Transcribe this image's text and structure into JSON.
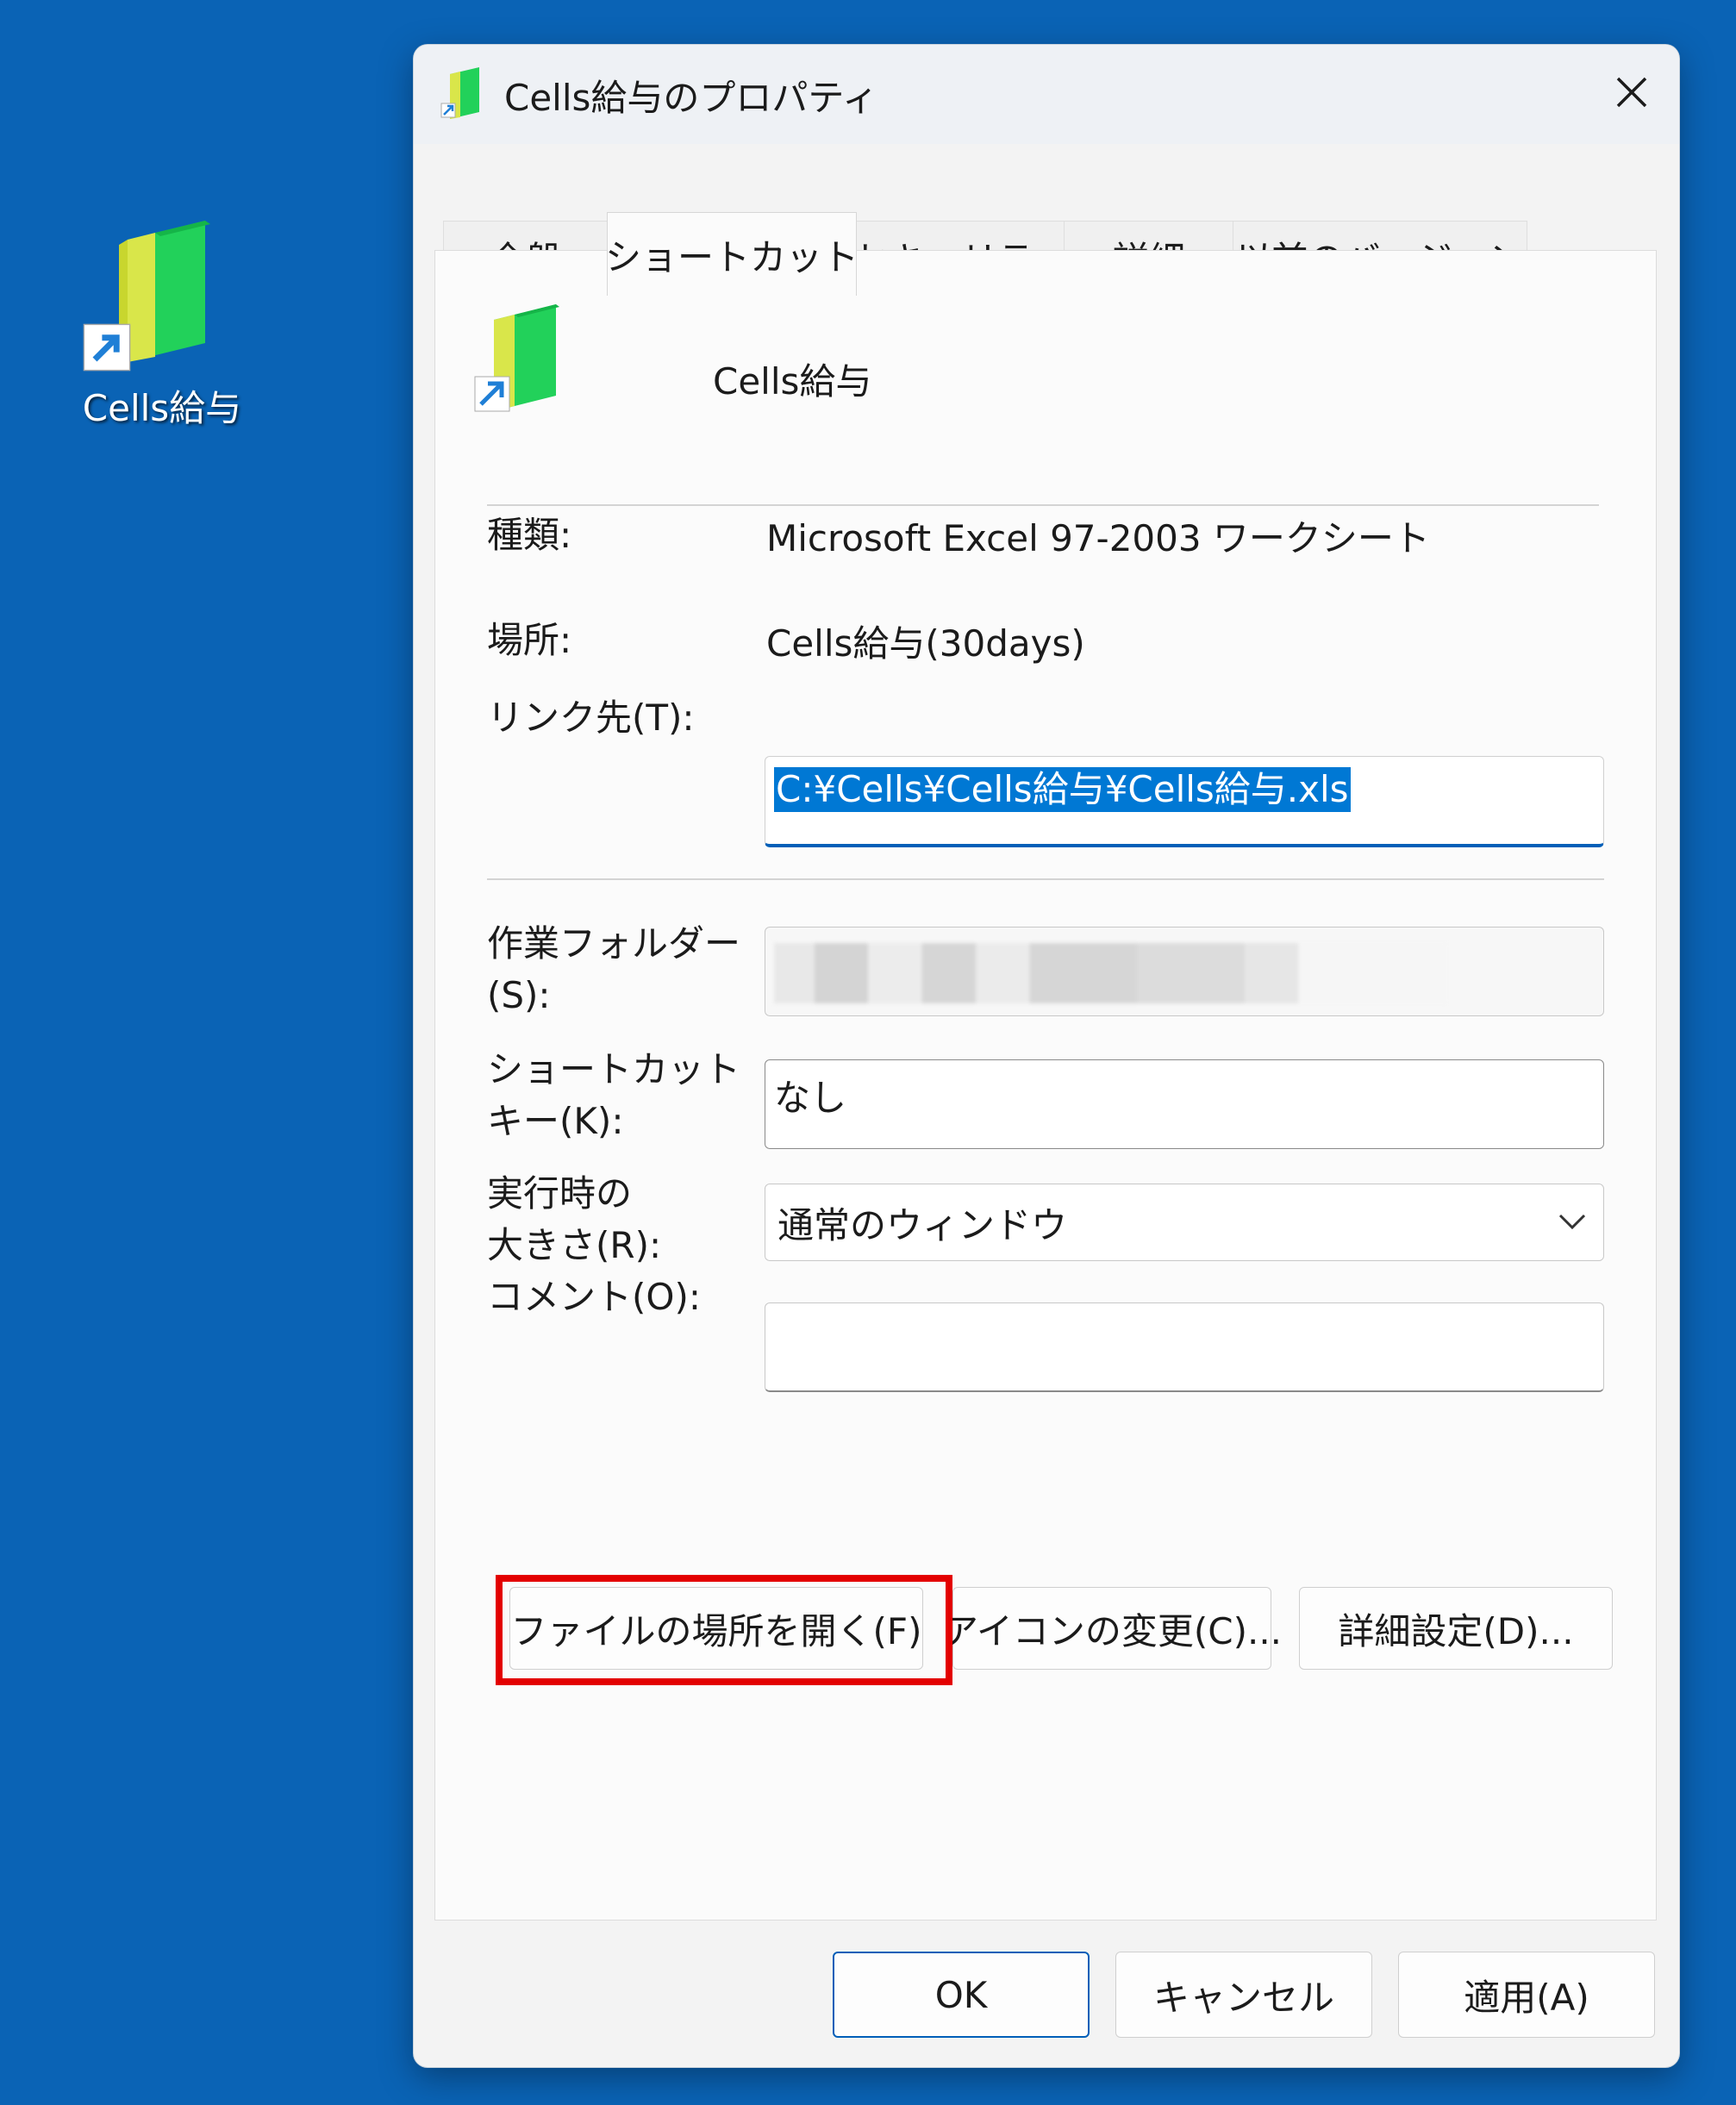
{
  "desktop": {
    "shortcut_label": "Cells給与"
  },
  "dialog": {
    "title": "Cells給与のプロパティ",
    "tabs": [
      {
        "label": "全般"
      },
      {
        "label": "ショートカット"
      },
      {
        "label": "セキュリティ"
      },
      {
        "label": "詳細"
      },
      {
        "label": "以前のバージョン"
      }
    ],
    "active_tab": "ショートカット",
    "file_name": "Cells給与",
    "fields": {
      "type_label": "種類:",
      "type_value": "Microsoft Excel 97-2003 ワークシート",
      "location_label": "場所:",
      "location_value": "Cells給与(30days)",
      "target_label": "リンク先(T):",
      "target_value": "C:¥Cells¥Cells給与¥Cells給与.xls",
      "workdir_label_line1": "作業フォルダー",
      "workdir_label_line2": "(S):",
      "hotkey_label_line1": "ショートカット",
      "hotkey_label_line2": "キー(K):",
      "hotkey_value": "なし",
      "run_label_line1": "実行時の",
      "run_label_line2": "大きさ(R):",
      "run_value": "通常のウィンドウ",
      "comment_label": "コメント(O):",
      "comment_value": ""
    },
    "buttons": {
      "open_location": "ファイルの場所を開く(F)",
      "change_icon": "アイコンの変更(C)...",
      "advanced": "詳細設定(D)...",
      "ok": "OK",
      "cancel": "キャンセル",
      "apply": "適用(A)"
    }
  },
  "colors": {
    "desktop_bg": "#0a63b5",
    "accent": "#005fb8",
    "selection": "#0078d4",
    "highlight_box": "#e30000"
  }
}
